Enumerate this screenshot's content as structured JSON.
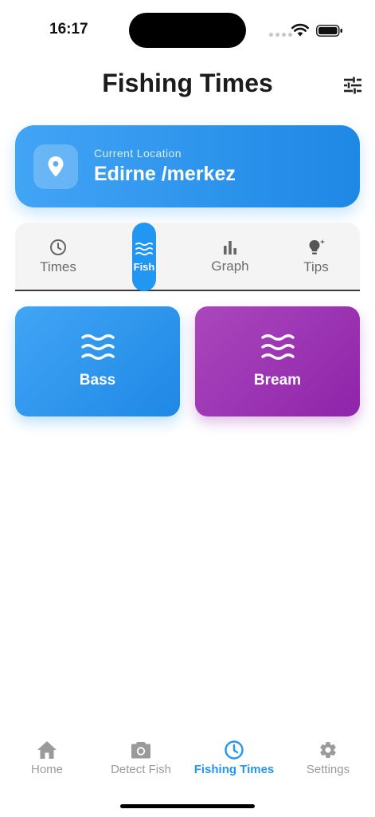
{
  "status_bar": {
    "time": "16:17"
  },
  "header": {
    "title": "Fishing Times",
    "filter_icon": "tune-icon"
  },
  "location": {
    "caption": "Current Location",
    "value": "Edirne /merkez",
    "icon": "location-pin-icon"
  },
  "tabs": [
    {
      "label": "Times",
      "icon": "clock-icon",
      "active": false
    },
    {
      "label": "Fish",
      "icon": "waves-icon",
      "active": true
    },
    {
      "label": "Graph",
      "icon": "bar-chart-icon",
      "active": false
    },
    {
      "label": "Tips",
      "icon": "lightbulb-icon",
      "active": false
    }
  ],
  "fish_cards": [
    {
      "label": "Bass",
      "color": "#1e88e5",
      "icon": "waves-icon"
    },
    {
      "label": "Bream",
      "color": "#8e24aa",
      "icon": "waves-icon"
    }
  ],
  "bottom_nav": [
    {
      "label": "Home",
      "icon": "home-icon",
      "active": false
    },
    {
      "label": "Detect Fish",
      "icon": "camera-icon",
      "active": false
    },
    {
      "label": "Fishing Times",
      "icon": "clock-icon",
      "active": true
    },
    {
      "label": "Settings",
      "icon": "gear-icon",
      "active": false
    }
  ],
  "colors": {
    "accent": "#2196f3",
    "inactive": "#9a9a9a"
  }
}
